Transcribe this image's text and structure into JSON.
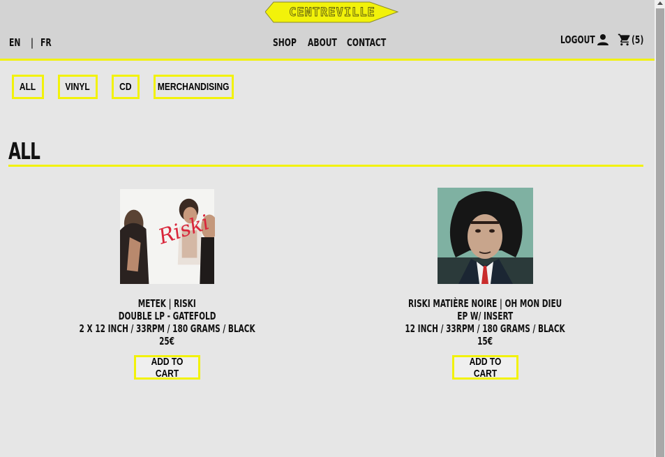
{
  "colors": {
    "accent": "#f2f20a",
    "header_bg": "#d3d3d3",
    "page_bg": "#e6e6e6"
  },
  "logo": {
    "text": "CENTREVILLE"
  },
  "lang": {
    "en": "EN",
    "sep": "|",
    "fr": "FR"
  },
  "nav": {
    "shop": "SHOP",
    "about": "ABOUT",
    "contact": "CONTACT"
  },
  "account": {
    "logout": "LOGOUT",
    "user_icon": "user-icon",
    "cart_icon": "cart-icon",
    "cart_count": "(5)"
  },
  "filters": [
    "ALL",
    "VINYL",
    "CD",
    "MERCHANDISING"
  ],
  "section": {
    "title": "ALL"
  },
  "products": [
    {
      "title": "METEK | RISKI",
      "format": "DOUBLE LP - GATEFOLD",
      "specs": "2 X 12 INCH / 33RPM / 180 GRAMS / BLACK",
      "price": "25€",
      "cover_text": "Riski",
      "button": "ADD TO CART"
    },
    {
      "title": "RISKI MATIÈRE NOIRE | OH MON DIEU",
      "format": "EP W/ INSERT",
      "specs": "12 INCH / 33RPM / 180 GRAMS / BLACK",
      "price": "15€",
      "button": "ADD TO CART"
    }
  ]
}
